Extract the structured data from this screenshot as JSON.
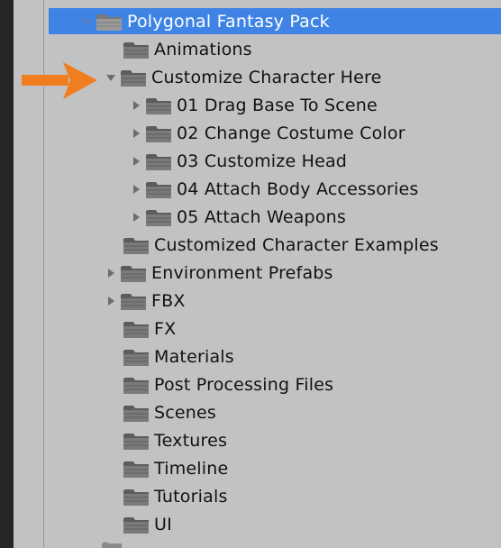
{
  "colors": {
    "panel_bg": "#c2c2c2",
    "selection": "#3f84e5",
    "pointer_arrow": "#f07d1e",
    "folder": "#6f6f6f"
  },
  "tree": {
    "root": {
      "label": "Polygonal Fantasy Pack",
      "expanded": true,
      "selected": true
    },
    "items": [
      {
        "label": "Animations"
      },
      {
        "label": "Customize Character Here",
        "expanded": true
      },
      {
        "label": "01 Drag Base To Scene"
      },
      {
        "label": "02 Change Costume Color"
      },
      {
        "label": "03 Customize Head"
      },
      {
        "label": "04 Attach Body Accessories"
      },
      {
        "label": "05 Attach Weapons"
      },
      {
        "label": "Customized Character Examples"
      },
      {
        "label": "Environment Prefabs"
      },
      {
        "label": "FBX"
      },
      {
        "label": "FX"
      },
      {
        "label": "Materials"
      },
      {
        "label": "Post Processing Files"
      },
      {
        "label": "Scenes"
      },
      {
        "label": "Textures"
      },
      {
        "label": "Timeline"
      },
      {
        "label": "Tutorials"
      },
      {
        "label": "UI"
      }
    ]
  },
  "icons": {
    "folder": "folder-icon",
    "expanded": "triangle-down-icon",
    "collapsed": "triangle-right-icon",
    "pointer": "arrow-right-icon"
  }
}
